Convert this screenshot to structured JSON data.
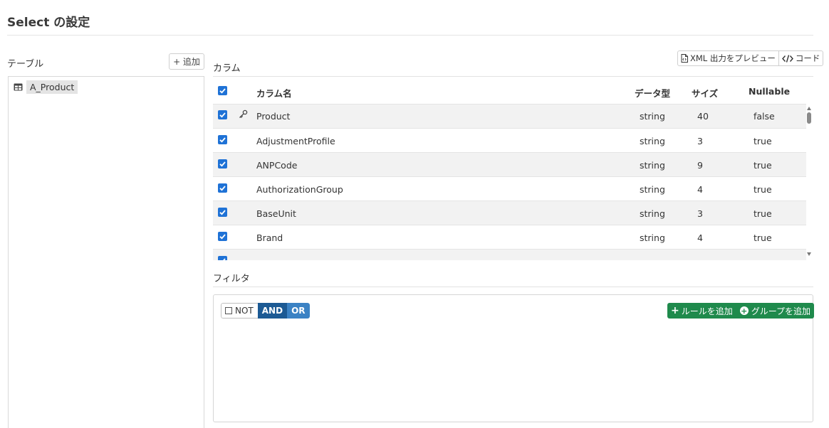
{
  "page": {
    "title": "Select の設定"
  },
  "tables": {
    "label": "テーブル",
    "add_label": "+ 追加",
    "items": [
      {
        "name": "A_Product",
        "icon": "table-icon"
      }
    ]
  },
  "columns": {
    "label": "カラム",
    "preview_label": "XML 出力をプレビュー",
    "preview_icon": "file-code-icon",
    "code_label": "コード",
    "code_icon": "code-icon",
    "headers": {
      "name": "カラム名",
      "type": "データ型",
      "size": "サイズ",
      "nullable": "Nullable"
    },
    "rows": [
      {
        "name": "Product",
        "type": "string",
        "size": "40",
        "nullable": "false",
        "key": true,
        "checked": true
      },
      {
        "name": "AdjustmentProfile",
        "type": "string",
        "size": "3",
        "nullable": "true",
        "key": false,
        "checked": true
      },
      {
        "name": "ANPCode",
        "type": "string",
        "size": "9",
        "nullable": "true",
        "key": false,
        "checked": true
      },
      {
        "name": "AuthorizationGroup",
        "type": "string",
        "size": "4",
        "nullable": "true",
        "key": false,
        "checked": true
      },
      {
        "name": "BaseUnit",
        "type": "string",
        "size": "3",
        "nullable": "true",
        "key": false,
        "checked": true
      },
      {
        "name": "Brand",
        "type": "string",
        "size": "4",
        "nullable": "true",
        "key": false,
        "checked": true
      }
    ]
  },
  "filter": {
    "label": "フィルタ",
    "not_label": "NOT",
    "and_label": "AND",
    "or_label": "OR",
    "add_rule_label": "ルールを追加",
    "add_group_label": "グループを追加"
  },
  "colors": {
    "checkbox": "#1f72d6",
    "and_active": "#1c5a94",
    "or": "#3b82c4",
    "add_green": "#1f8a4c"
  }
}
